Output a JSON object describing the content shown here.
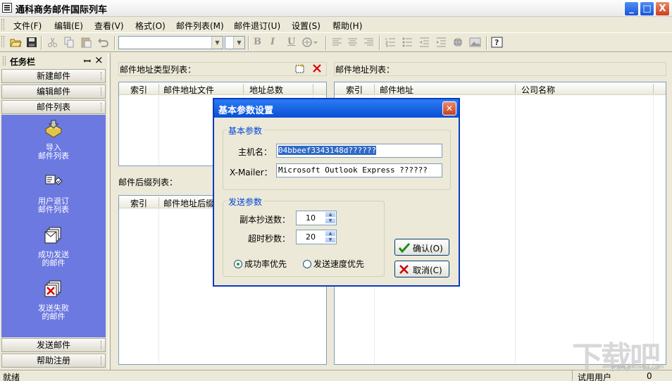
{
  "app": {
    "title": "通科商务邮件国际列车"
  },
  "window_buttons": {
    "minimize": "_",
    "maximize": "□",
    "close": "X"
  },
  "menu": [
    "文件(F)",
    "编辑(E)",
    "查看(V)",
    "格式(O)",
    "邮件列表(M)",
    "邮件退订(U)",
    "设置(S)",
    "帮助(H)"
  ],
  "toolbar": {
    "bold": "B",
    "italic": "I",
    "underline": "U"
  },
  "task_pane": {
    "title": "任务栏",
    "pin": "ꟷ",
    "close": "×",
    "top_tabs": [
      "新建邮件",
      "编辑邮件",
      "邮件列表"
    ],
    "entries": [
      {
        "line1": "导入",
        "line2": "邮件列表",
        "icon": "import-icon"
      },
      {
        "line1": "用户退订",
        "line2": "邮件列表",
        "icon": "unsubscribe-icon"
      },
      {
        "line1": "成功发送",
        "line2": "的邮件",
        "icon": "sent-success-icon"
      },
      {
        "line1": "发送失败",
        "line2": "的邮件",
        "icon": "sent-failed-icon"
      }
    ],
    "bottom_tabs": [
      "发送邮件",
      "帮助注册"
    ]
  },
  "panels": {
    "type_list": {
      "label": "邮件地址类型列表：",
      "columns": [
        "索引",
        "邮件地址文件",
        "地址总数"
      ]
    },
    "suffix_list": {
      "label": "邮件后缀列表：",
      "columns": [
        "索引",
        "邮件地址后缀"
      ]
    },
    "address_list": {
      "label": "邮件地址列表：",
      "columns": [
        "索引",
        "邮件地址",
        "公司名称"
      ]
    }
  },
  "dialog": {
    "title": "基本参数设置",
    "basic_group": "基本参数",
    "host_label": "主机名：",
    "host_value": "04bbeef3343148d??????",
    "mailer_label": "X-Mailer：",
    "mailer_value": "Microsoft Outlook Express ??????",
    "send_group": "发送参数",
    "copies_label": "副本抄送数：",
    "copies_value": "10",
    "timeout_label": "超时秒数：",
    "timeout_value": "20",
    "radio_success": "成功率优先",
    "radio_speed": "发送速度优先",
    "radio_selected": "success",
    "ok_label": "确认(O)",
    "cancel_label": "取消(C)"
  },
  "status": {
    "left": "就绪",
    "user": "试用用户",
    "count": "0"
  },
  "watermark": {
    "text": "下载吧",
    "url": "www.xiazaiba.com"
  }
}
